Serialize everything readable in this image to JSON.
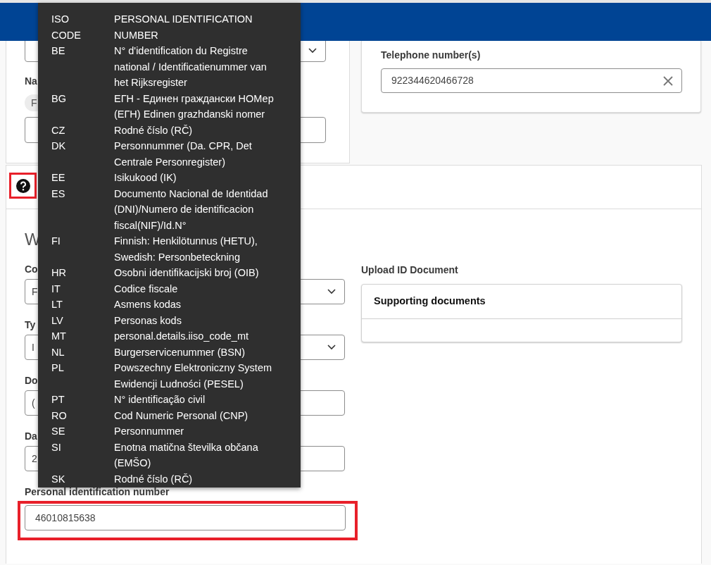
{
  "personal_card": {
    "name_label": "Na",
    "name_chip": "F"
  },
  "contact_card": {
    "phone_label": "Telephone number(s)",
    "phone_value": "922344620466728"
  },
  "identity_card": {
    "help_icon": {
      "highlighted": true
    },
    "heading": "W",
    "fields": [
      {
        "kind": "select",
        "label": "Co",
        "value": "F",
        "highlighted": false
      },
      {
        "kind": "select",
        "label": "Ty",
        "value": "I",
        "highlighted": false
      },
      {
        "kind": "input",
        "label": "Do",
        "value": "(",
        "highlighted": false
      },
      {
        "kind": "input",
        "label": "Da",
        "value": "2",
        "highlighted": false
      },
      {
        "kind": "input",
        "label": "Personal identification number",
        "value": "46010815638",
        "highlighted": true
      }
    ],
    "upload": {
      "label": "Upload ID Document",
      "panel_title": "Supporting documents"
    }
  },
  "tooltip": {
    "header": {
      "code": "ISO CODE",
      "number": "PERSONAL IDENTIFICATION NUMBER"
    },
    "rows": [
      {
        "code": "BE",
        "number": "N° d'identification du Registre national / Identificatienummer van het Rijksregister"
      },
      {
        "code": "BG",
        "number": "ЕГН - Единен граждански НОМер (ЕГН) Edinen grazhdanski nomer"
      },
      {
        "code": "CZ",
        "number": "Rodné číslo (RČ)"
      },
      {
        "code": "DK",
        "number": "Personnummer (Da. CPR, Det Centrale Personregister)"
      },
      {
        "code": "EE",
        "number": "Isikukood (IK)"
      },
      {
        "code": "ES",
        "number": "Documento Nacional de Identidad (DNI)/Numero de identificacion fiscal(NIF)/Id.N°"
      },
      {
        "code": "FI",
        "number": "Finnish: Henkilötunnus (HETU), Swedish: Personbeteckning"
      },
      {
        "code": "HR",
        "number": "Osobni identifikacijski broj (OIB)"
      },
      {
        "code": "IT",
        "number": "Codice fiscale"
      },
      {
        "code": "LT",
        "number": "Asmens kodas"
      },
      {
        "code": "LV",
        "number": "Personas kods"
      },
      {
        "code": "MT",
        "number": "personal.details.iiso_code_mt"
      },
      {
        "code": "NL",
        "number": "Burgerservicenummer (BSN)"
      },
      {
        "code": "PL",
        "number": "Powszechny Elektroniczny System Ewidencji Ludności (PESEL)"
      },
      {
        "code": "PT",
        "number": "N° identificação civil"
      },
      {
        "code": "RO",
        "number": "Cod Numeric Personal (CNP)"
      },
      {
        "code": "SE",
        "number": "Personnummer"
      },
      {
        "code": "SI",
        "number": "Enotna matična številka občana (EMŠO)"
      },
      {
        "code": "SK",
        "number": "Rodné číslo (RČ)"
      }
    ]
  }
}
